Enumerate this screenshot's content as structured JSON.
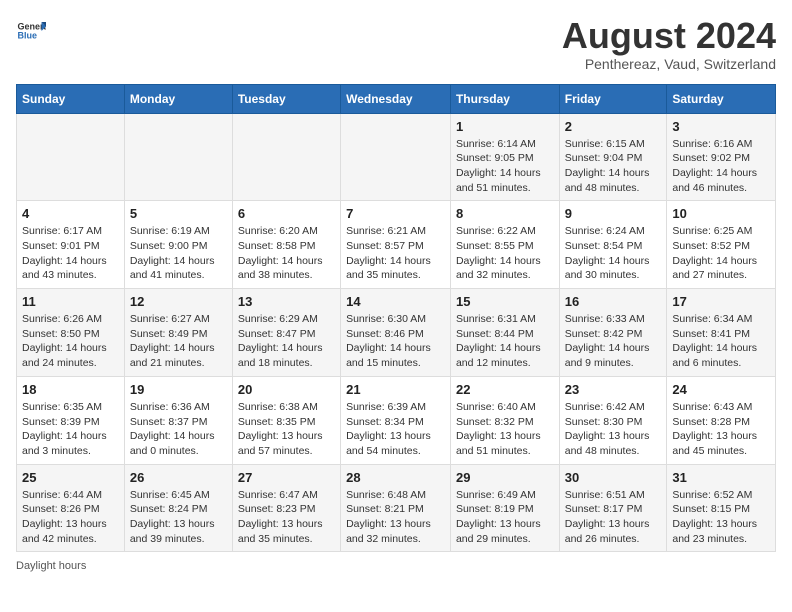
{
  "header": {
    "logo_general": "General",
    "logo_blue": "Blue",
    "main_title": "August 2024",
    "subtitle": "Penthereaz, Vaud, Switzerland"
  },
  "days_of_week": [
    "Sunday",
    "Monday",
    "Tuesday",
    "Wednesday",
    "Thursday",
    "Friday",
    "Saturday"
  ],
  "weeks": [
    [
      {
        "num": "",
        "info": ""
      },
      {
        "num": "",
        "info": ""
      },
      {
        "num": "",
        "info": ""
      },
      {
        "num": "",
        "info": ""
      },
      {
        "num": "1",
        "info": "Sunrise: 6:14 AM\nSunset: 9:05 PM\nDaylight: 14 hours and 51 minutes."
      },
      {
        "num": "2",
        "info": "Sunrise: 6:15 AM\nSunset: 9:04 PM\nDaylight: 14 hours and 48 minutes."
      },
      {
        "num": "3",
        "info": "Sunrise: 6:16 AM\nSunset: 9:02 PM\nDaylight: 14 hours and 46 minutes."
      }
    ],
    [
      {
        "num": "4",
        "info": "Sunrise: 6:17 AM\nSunset: 9:01 PM\nDaylight: 14 hours and 43 minutes."
      },
      {
        "num": "5",
        "info": "Sunrise: 6:19 AM\nSunset: 9:00 PM\nDaylight: 14 hours and 41 minutes."
      },
      {
        "num": "6",
        "info": "Sunrise: 6:20 AM\nSunset: 8:58 PM\nDaylight: 14 hours and 38 minutes."
      },
      {
        "num": "7",
        "info": "Sunrise: 6:21 AM\nSunset: 8:57 PM\nDaylight: 14 hours and 35 minutes."
      },
      {
        "num": "8",
        "info": "Sunrise: 6:22 AM\nSunset: 8:55 PM\nDaylight: 14 hours and 32 minutes."
      },
      {
        "num": "9",
        "info": "Sunrise: 6:24 AM\nSunset: 8:54 PM\nDaylight: 14 hours and 30 minutes."
      },
      {
        "num": "10",
        "info": "Sunrise: 6:25 AM\nSunset: 8:52 PM\nDaylight: 14 hours and 27 minutes."
      }
    ],
    [
      {
        "num": "11",
        "info": "Sunrise: 6:26 AM\nSunset: 8:50 PM\nDaylight: 14 hours and 24 minutes."
      },
      {
        "num": "12",
        "info": "Sunrise: 6:27 AM\nSunset: 8:49 PM\nDaylight: 14 hours and 21 minutes."
      },
      {
        "num": "13",
        "info": "Sunrise: 6:29 AM\nSunset: 8:47 PM\nDaylight: 14 hours and 18 minutes."
      },
      {
        "num": "14",
        "info": "Sunrise: 6:30 AM\nSunset: 8:46 PM\nDaylight: 14 hours and 15 minutes."
      },
      {
        "num": "15",
        "info": "Sunrise: 6:31 AM\nSunset: 8:44 PM\nDaylight: 14 hours and 12 minutes."
      },
      {
        "num": "16",
        "info": "Sunrise: 6:33 AM\nSunset: 8:42 PM\nDaylight: 14 hours and 9 minutes."
      },
      {
        "num": "17",
        "info": "Sunrise: 6:34 AM\nSunset: 8:41 PM\nDaylight: 14 hours and 6 minutes."
      }
    ],
    [
      {
        "num": "18",
        "info": "Sunrise: 6:35 AM\nSunset: 8:39 PM\nDaylight: 14 hours and 3 minutes."
      },
      {
        "num": "19",
        "info": "Sunrise: 6:36 AM\nSunset: 8:37 PM\nDaylight: 14 hours and 0 minutes."
      },
      {
        "num": "20",
        "info": "Sunrise: 6:38 AM\nSunset: 8:35 PM\nDaylight: 13 hours and 57 minutes."
      },
      {
        "num": "21",
        "info": "Sunrise: 6:39 AM\nSunset: 8:34 PM\nDaylight: 13 hours and 54 minutes."
      },
      {
        "num": "22",
        "info": "Sunrise: 6:40 AM\nSunset: 8:32 PM\nDaylight: 13 hours and 51 minutes."
      },
      {
        "num": "23",
        "info": "Sunrise: 6:42 AM\nSunset: 8:30 PM\nDaylight: 13 hours and 48 minutes."
      },
      {
        "num": "24",
        "info": "Sunrise: 6:43 AM\nSunset: 8:28 PM\nDaylight: 13 hours and 45 minutes."
      }
    ],
    [
      {
        "num": "25",
        "info": "Sunrise: 6:44 AM\nSunset: 8:26 PM\nDaylight: 13 hours and 42 minutes."
      },
      {
        "num": "26",
        "info": "Sunrise: 6:45 AM\nSunset: 8:24 PM\nDaylight: 13 hours and 39 minutes."
      },
      {
        "num": "27",
        "info": "Sunrise: 6:47 AM\nSunset: 8:23 PM\nDaylight: 13 hours and 35 minutes."
      },
      {
        "num": "28",
        "info": "Sunrise: 6:48 AM\nSunset: 8:21 PM\nDaylight: 13 hours and 32 minutes."
      },
      {
        "num": "29",
        "info": "Sunrise: 6:49 AM\nSunset: 8:19 PM\nDaylight: 13 hours and 29 minutes."
      },
      {
        "num": "30",
        "info": "Sunrise: 6:51 AM\nSunset: 8:17 PM\nDaylight: 13 hours and 26 minutes."
      },
      {
        "num": "31",
        "info": "Sunrise: 6:52 AM\nSunset: 8:15 PM\nDaylight: 13 hours and 23 minutes."
      }
    ]
  ],
  "footer": {
    "note": "Daylight hours"
  }
}
